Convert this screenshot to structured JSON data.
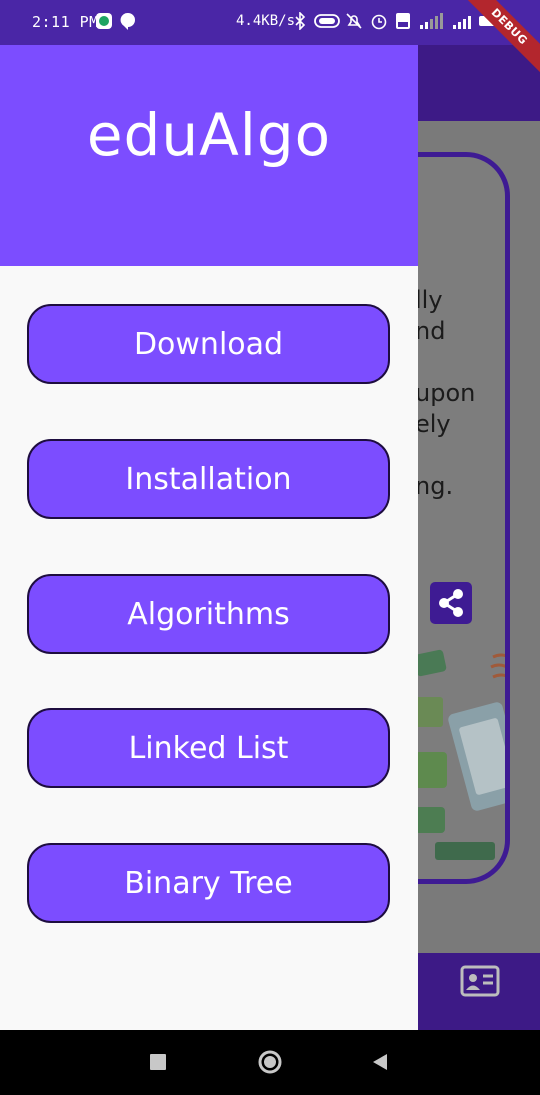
{
  "status_bar": {
    "time": "2:11 PM",
    "network_speed": "4.4KB/s",
    "icons": [
      "chat-app-icon",
      "hangouts-icon",
      "bluetooth-icon",
      "battery-saver-icon",
      "mute-icon",
      "alarm-icon",
      "volte-icon",
      "signal-icon",
      "signal-icon-2",
      "battery-icon"
    ]
  },
  "debug_banner": "DEBUG",
  "drawer": {
    "title": "eduAlgo",
    "items": [
      {
        "label": "Download"
      },
      {
        "label": "Installation"
      },
      {
        "label": "Algorithms"
      },
      {
        "label": "Linked List"
      },
      {
        "label": "Binary Tree"
      }
    ]
  },
  "background_page": {
    "text_lines": [
      "lly",
      "nd",
      "",
      "upon",
      "ely",
      "",
      "ng."
    ],
    "share_icon": "share-icon",
    "bottom_icon": "contact-card-icon"
  },
  "colors": {
    "accent": "#7c4dff",
    "app_bar": "#3d1a86",
    "status_bar": "#4a26a6"
  }
}
